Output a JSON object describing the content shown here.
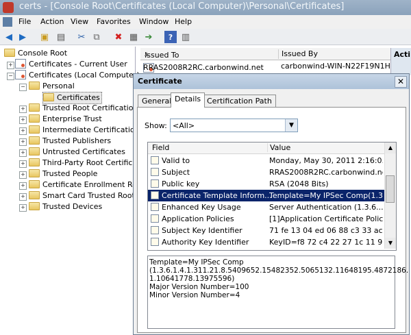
{
  "window": {
    "title": "certs - [Console Root\\Certificates (Local Computer)\\Personal\\Certificates]"
  },
  "menu": [
    "File",
    "Action",
    "View",
    "Favorites",
    "Window",
    "Help"
  ],
  "toolbar_icons": [
    "back-icon",
    "forward-icon",
    "up-folder-icon",
    "show-hide-tree-icon",
    "cut-icon",
    "copy-icon",
    "delete-icon",
    "properties-icon",
    "export-icon",
    "help-icon",
    "action-pane-icon"
  ],
  "tree": {
    "items": [
      {
        "label": "Console Root"
      },
      {
        "label": "Certificates - Current User"
      },
      {
        "label": "Certificates (Local Computer)"
      },
      {
        "label": "Personal"
      },
      {
        "label": "Certificates"
      },
      {
        "label": "Trusted Root Certification"
      },
      {
        "label": "Enterprise Trust"
      },
      {
        "label": "Intermediate Certification"
      },
      {
        "label": "Trusted Publishers"
      },
      {
        "label": "Untrusted Certificates"
      },
      {
        "label": "Third-Party Root Certificat"
      },
      {
        "label": "Trusted People"
      },
      {
        "label": "Certificate Enrollment Requ"
      },
      {
        "label": "Smart Card Trusted Roots"
      },
      {
        "label": "Trusted Devices"
      }
    ]
  },
  "list": {
    "col_issued_to": "Issued To",
    "col_issued_by": "Issued By",
    "row_issued_to": "RRAS2008R2RC.carbonwind.net",
    "row_issued_by": "carbonwind-WIN-N22F19N1H07",
    "actions_header": "Acti"
  },
  "dialog": {
    "title": "Certificate",
    "close": "✕",
    "tabs": [
      "General",
      "Details",
      "Certification Path"
    ],
    "show_label": "Show:",
    "show_value": "<All>",
    "grid_headers": {
      "field": "Field",
      "value": "Value"
    },
    "rows": [
      {
        "field": "Valid to",
        "value": "Monday, May 30, 2011 2:16:0..."
      },
      {
        "field": "Subject",
        "value": "RRAS2008R2RC.carbonwind.net"
      },
      {
        "field": "Public key",
        "value": "RSA (2048 Bits)"
      },
      {
        "field": "Certificate Template Inform...",
        "value": "Template=My IPSec Comp(1.3...."
      },
      {
        "field": "Enhanced Key Usage",
        "value": "Server Authentication (1.3.6...."
      },
      {
        "field": "Application Policies",
        "value": "[1]Application Certificate Polic..."
      },
      {
        "field": "Subject Key Identifier",
        "value": "71 fe 13 04 ed 06 88 c3 33 ac ..."
      },
      {
        "field": "Authority Key Identifier",
        "value": "KeyID=f8 72 c4 22 27 1c 11 9..."
      }
    ],
    "selected_row": 3,
    "detail_lines": [
      "Template=My IPSec Comp",
      "(1.3.6.1.4.1.311.21.8.5409652.15482352.5065132.11648195.4872186.",
      "1.10641778.13975596)",
      "Major Version Number=100",
      "Minor Version Number=4"
    ]
  }
}
